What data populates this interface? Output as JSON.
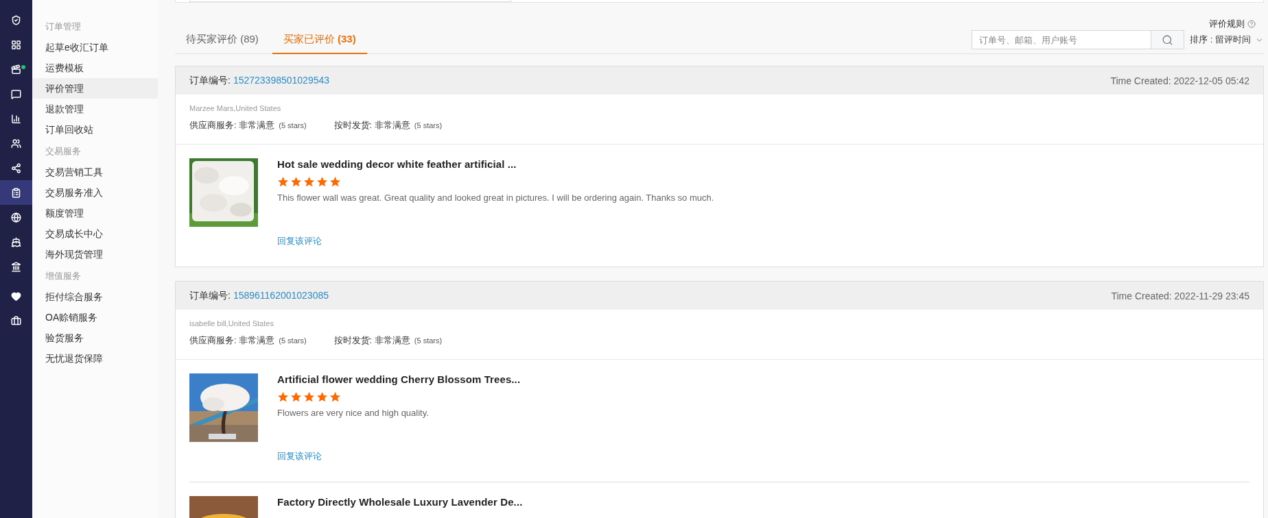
{
  "rail": [
    {
      "kind": "shield",
      "selected": false,
      "notification": false
    },
    {
      "kind": "grid",
      "selected": false,
      "notification": false
    },
    {
      "kind": "media",
      "selected": false,
      "notification": true
    },
    {
      "kind": "chat",
      "selected": false,
      "notification": false
    },
    {
      "kind": "chart",
      "selected": false,
      "notification": false
    },
    {
      "kind": "users",
      "selected": false,
      "notification": false
    },
    {
      "kind": "share",
      "selected": false,
      "notification": false
    },
    {
      "kind": "clipboard",
      "selected": true,
      "notification": false
    },
    {
      "kind": "globe",
      "selected": false,
      "notification": false
    },
    {
      "kind": "ship",
      "selected": false,
      "notification": false
    },
    {
      "kind": "bank",
      "selected": false,
      "notification": false
    },
    {
      "kind": "heart",
      "selected": false,
      "notification": false
    },
    {
      "kind": "briefcase",
      "selected": false,
      "notification": false
    }
  ],
  "menu": [
    {
      "title": "订单管理",
      "items": [
        {
          "label": "起草e收汇订单",
          "selected": false
        },
        {
          "label": "运费模板",
          "selected": false
        },
        {
          "label": "评价管理",
          "selected": true
        },
        {
          "label": "退款管理",
          "selected": false
        },
        {
          "label": "订单回收站",
          "selected": false
        }
      ]
    },
    {
      "title": "交易服务",
      "items": [
        {
          "label": "交易营销工具",
          "selected": false
        },
        {
          "label": "交易服务准入",
          "selected": false
        },
        {
          "label": "额度管理",
          "selected": false
        },
        {
          "label": "交易成长中心",
          "selected": false
        },
        {
          "label": "海外现货管理",
          "selected": false
        }
      ]
    },
    {
      "title": "增值服务",
      "items": [
        {
          "label": "拒付综合服务",
          "selected": false
        },
        {
          "label": "OA赊销服务",
          "selected": false
        },
        {
          "label": "验货服务",
          "selected": false
        },
        {
          "label": "无忧退货保障",
          "selected": false
        }
      ]
    }
  ],
  "rules_link": "评价规则",
  "tabs": [
    {
      "label": "待买家评价",
      "count": "(89)",
      "selected": false
    },
    {
      "label": "买家已评价",
      "count": "(33)",
      "selected": true
    }
  ],
  "search": {
    "placeholder": "订单号、邮箱、用户账号"
  },
  "sort": {
    "label": "排序 : 留评时间"
  },
  "cards": [
    {
      "order_label": "订单编号:",
      "order_number": "152723398501029543",
      "time": "Time Created: 2022-12-05 05:42",
      "buyer": "Marzee Mars,United States",
      "ratings": [
        {
          "label": "供应商服务:",
          "value": "非常满意",
          "stars_text": "(5 stars)"
        },
        {
          "label": "按时发货:",
          "value": "非常满意",
          "stars_text": "(5 stars)"
        }
      ],
      "products": [
        {
          "kind": "feathers",
          "title": "Hot sale wedding decor white feather artificial ...",
          "stars": 5,
          "comment": "This flower wall was great.  Great quality and looked great in pictures.  I will be ordering again.  Thanks so much.",
          "reply": "回复该评论"
        }
      ]
    },
    {
      "order_label": "订单编号:",
      "order_number": "158961162001023085",
      "time": "Time Created: 2022-11-29 23:45",
      "buyer": "isabelle bill,United States",
      "ratings": [
        {
          "label": "供应商服务:",
          "value": "非常满意",
          "stars_text": "(5 stars)"
        },
        {
          "label": "按时发货:",
          "value": "非常满意",
          "stars_text": "(5 stars)"
        }
      ],
      "products": [
        {
          "kind": "tree",
          "title": "Artificial flower wedding Cherry Blossom Trees...",
          "stars": 5,
          "comment": "Flowers are very nice and high quality.",
          "reply": "回复该评论"
        },
        {
          "kind": "lavender",
          "title": "Factory Directly Wholesale Luxury Lavender De..."
        }
      ]
    }
  ]
}
